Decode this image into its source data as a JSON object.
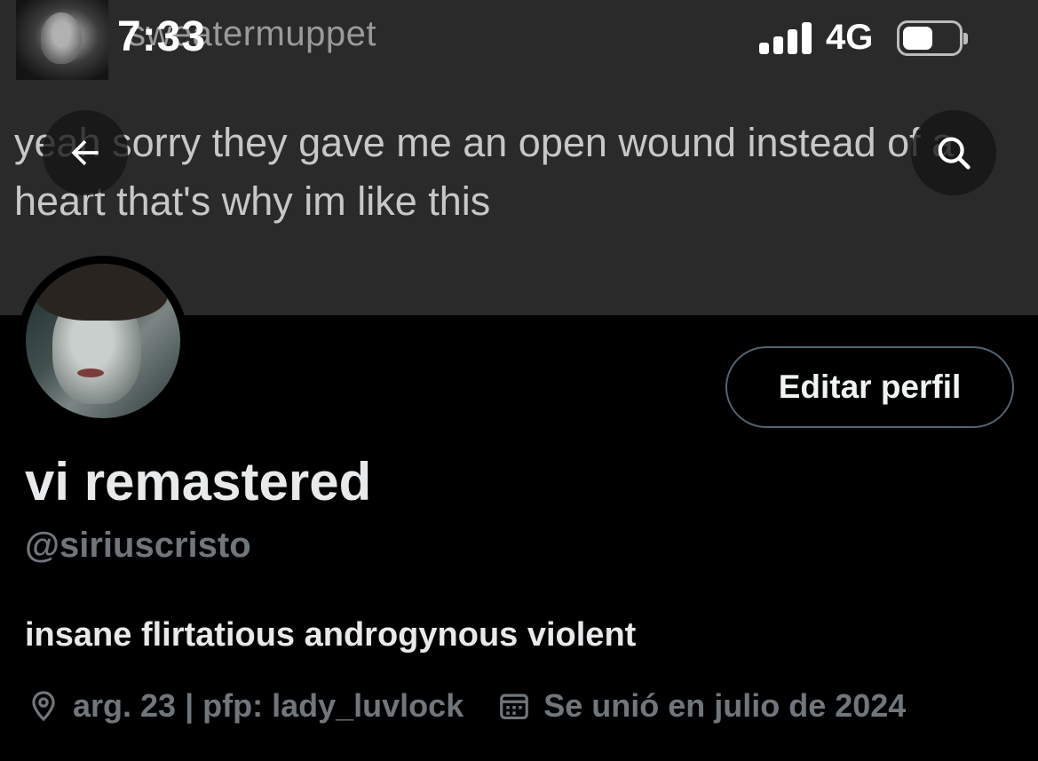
{
  "status_bar": {
    "time": "7:33",
    "network": "4G",
    "battery_level": 0.55
  },
  "banner": {
    "username": "sweatermuppet",
    "text": "yeah sorry they gave me an open wound instead of a heart that's why im like this"
  },
  "nav": {
    "back_icon": "arrow-left-icon",
    "search_icon": "search-icon"
  },
  "profile": {
    "display_name": "vi remastered",
    "handle": "@siriuscristo",
    "bio": "insane flirtatious androgynous violent",
    "location": "arg. 23 | pfp: lady_luvlock",
    "joined": "Se unió en julio de 2024",
    "edit_button_label": "Editar perfil"
  },
  "colors": {
    "background": "#000000",
    "banner": "#2a2a2a",
    "primary_text": "#e7e9ea",
    "secondary_text": "#71767b",
    "button_border": "#536471"
  }
}
